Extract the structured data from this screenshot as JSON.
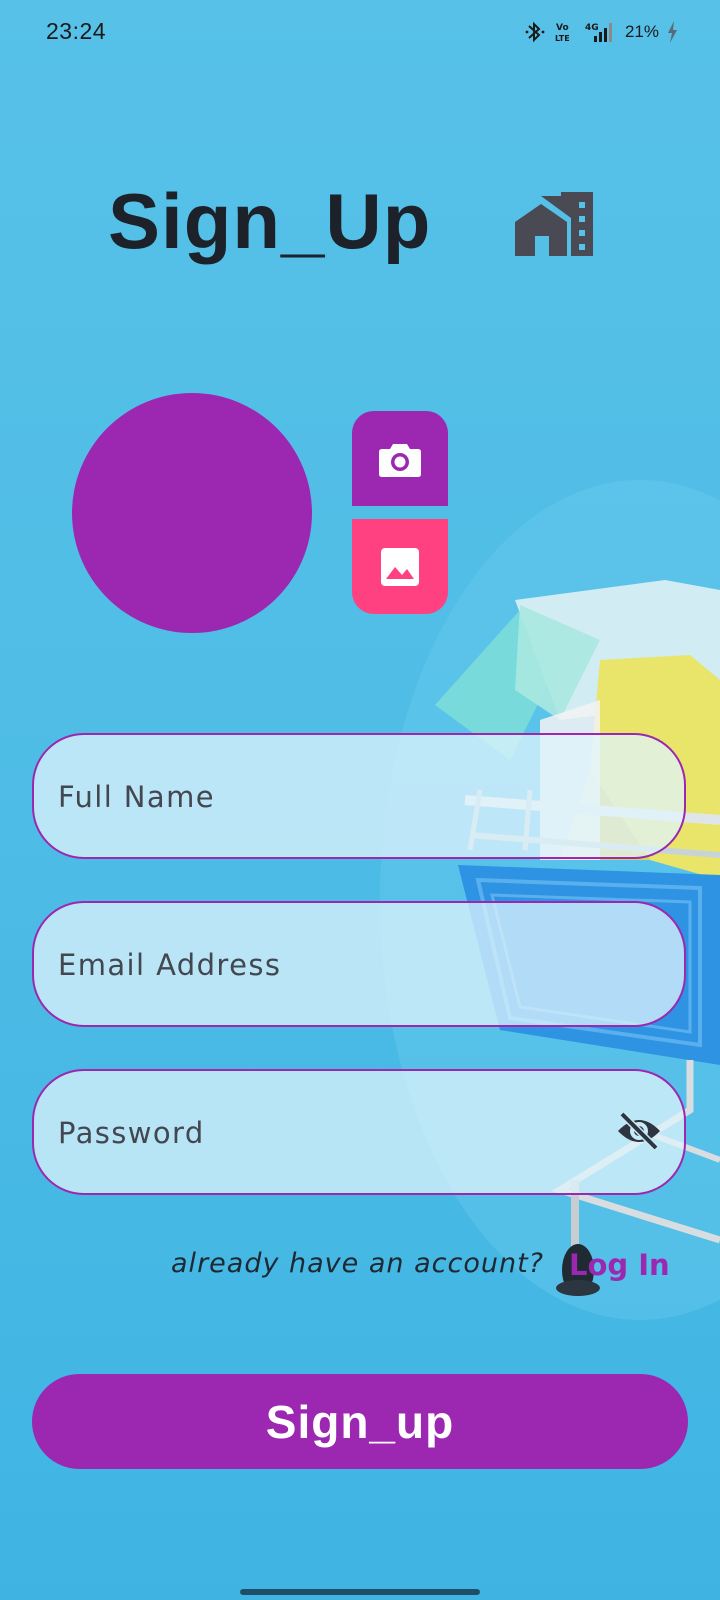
{
  "status_bar": {
    "time": "23:24",
    "battery_text": "21%",
    "icons": [
      "bluetooth-icon",
      "volte-icon",
      "signal-4g-icon",
      "battery-charging-icon"
    ]
  },
  "header": {
    "title": "Sign_Up",
    "icon": "home-icon"
  },
  "photo_picker": {
    "camera_icon": "camera-icon",
    "gallery_icon": "image-icon"
  },
  "form": {
    "full_name": {
      "placeholder": "Full Name",
      "value": ""
    },
    "email": {
      "placeholder": "Email Address",
      "value": ""
    },
    "password": {
      "placeholder": "Password",
      "value": "",
      "toggle_icon": "visibility-off-icon"
    }
  },
  "login": {
    "prompt": "already have an account?",
    "link_label": "Log In"
  },
  "submit": {
    "label": "Sign_up"
  },
  "colors": {
    "accent": "#9c27b0",
    "gallery": "#ff4081",
    "background": "#4fbde6",
    "title": "#1d2129"
  }
}
